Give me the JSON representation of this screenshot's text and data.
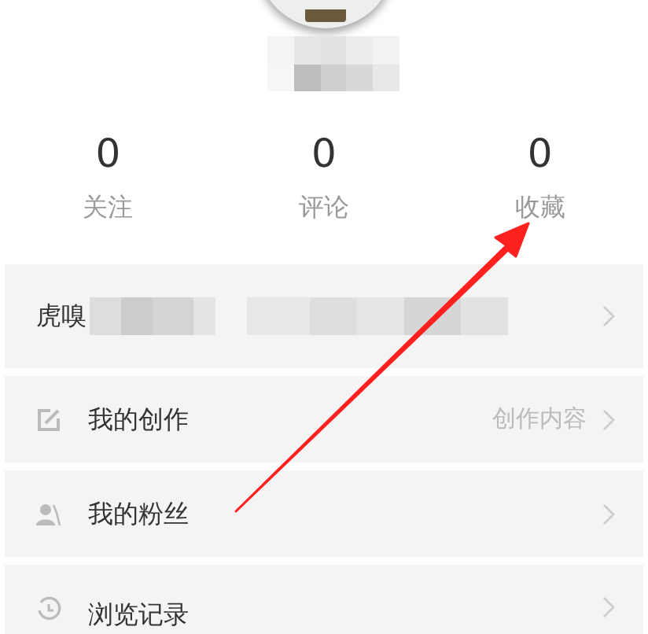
{
  "stats": [
    {
      "value": "0",
      "label": "关注"
    },
    {
      "value": "0",
      "label": "评论"
    },
    {
      "value": "0",
      "label": "收藏"
    }
  ],
  "menu": [
    {
      "kind": "account",
      "label": "虎嗅"
    },
    {
      "kind": "edit",
      "label": "我的创作",
      "detail": "创作内容"
    },
    {
      "kind": "fans",
      "label": "我的粉丝"
    },
    {
      "kind": "history",
      "label": "浏览记录"
    }
  ]
}
